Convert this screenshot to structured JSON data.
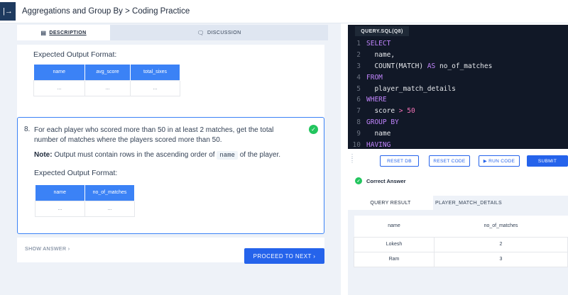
{
  "header": {
    "toggle_icon": "|→",
    "title": "Aggregations and Group By > Coding Practice"
  },
  "tabs": [
    {
      "label": "DESCRIPTION",
      "icon": "▤"
    },
    {
      "label": "DISCUSSION",
      "icon": "🗨"
    }
  ],
  "question7": {
    "format_label": "Expected Output Format:",
    "columns": [
      "name",
      "avg_score",
      "total_sixes"
    ],
    "row": [
      "...",
      "...",
      "..."
    ]
  },
  "question8": {
    "number": "8.",
    "text": "For each player who scored more than 50 in at least 2 matches, get the total number of matches where the players scored more than 50.",
    "note_label": "Note:",
    "note_text": " Output must contain rows in the ascending order of ",
    "note_code": "name",
    "note_tail": " of the player.",
    "format_label": "Expected Output Format:",
    "columns": [
      "name",
      "no_of_matches"
    ],
    "row": [
      "...",
      "..."
    ],
    "check_icon": "✓"
  },
  "show_answer": "SHOW ANSWER ›",
  "proceed": "PROCEED TO NEXT ›",
  "editor": {
    "tab": "QUERY.SQL(Q8)",
    "lines": [
      {
        "n": "1",
        "kw": "SELECT",
        "tx": ""
      },
      {
        "n": "2",
        "kw": "",
        "tx": "  name,"
      },
      {
        "n": "3",
        "kw": "",
        "tx": "  COUNT(MATCH) AS no_of_matches"
      },
      {
        "n": "4",
        "kw": "FROM",
        "tx": ""
      },
      {
        "n": "5",
        "kw": "",
        "tx": "  player_match_details"
      },
      {
        "n": "6",
        "kw": "WHERE",
        "tx": ""
      },
      {
        "n": "7",
        "kw": "",
        "tx": "  score > 50"
      },
      {
        "n": "8",
        "kw": "GROUP BY",
        "tx": ""
      },
      {
        "n": "9",
        "kw": "",
        "tx": "  name"
      },
      {
        "n": "10",
        "kw": "HAVING",
        "tx": ""
      }
    ]
  },
  "actions": {
    "reset_db": "RESET DB",
    "reset_code": "RESET CODE",
    "run_code": "▶ RUN CODE",
    "submit": "SUBMIT"
  },
  "result": {
    "status": "Correct Answer",
    "tabs": [
      "QUERY RESULT",
      "PLAYER_MATCH_DETAILS"
    ],
    "columns": [
      "name",
      "no_of_matches"
    ],
    "rows": [
      [
        "Lokesh",
        "2"
      ],
      [
        "Ram",
        "3"
      ]
    ]
  },
  "colors": {
    "accent": "#2563eb",
    "success": "#22c55e",
    "editor_bg": "#111827"
  }
}
